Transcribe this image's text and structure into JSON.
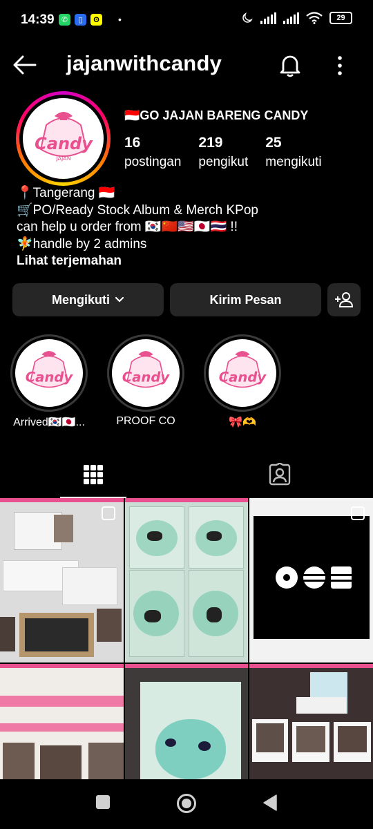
{
  "status_bar": {
    "time": "14:39",
    "battery": "29",
    "icons": [
      "whatsapp-icon",
      "phone-app-icon",
      "snapchat-icon",
      "moon-icon",
      "signal-icon",
      "wifi-icon"
    ]
  },
  "header": {
    "username": "jajanwithcandy"
  },
  "profile": {
    "avatar_text": "Candy",
    "avatar_subtext": "JAJAN",
    "display_name": "🇮🇩GO JAJAN BARENG CANDY",
    "stats": [
      {
        "value": "16",
        "label": "postingan"
      },
      {
        "value": "219",
        "label": "pengikut"
      },
      {
        "value": "25",
        "label": "mengikuti"
      }
    ],
    "bio": [
      "📍Tangerang 🇮🇩",
      "🛒PO/Ready Stock Album & Merch KPop",
      "can help u order from 🇰🇷🇨🇳🇺🇸🇯🇵🇹🇭 !!",
      "🧚handle by 2 admins"
    ],
    "translate": "Lihat terjemahan"
  },
  "actions": {
    "follow": "Mengikuti",
    "message": "Kirim Pesan"
  },
  "highlights": [
    {
      "label": "Arrived🇰🇷🇯🇵..."
    },
    {
      "label": "PROOF CO"
    },
    {
      "label": "🎀🫶"
    }
  ],
  "colors": {
    "button_bg": "#262626",
    "brand_pink": "#e8508f",
    "background": "#000000"
  }
}
